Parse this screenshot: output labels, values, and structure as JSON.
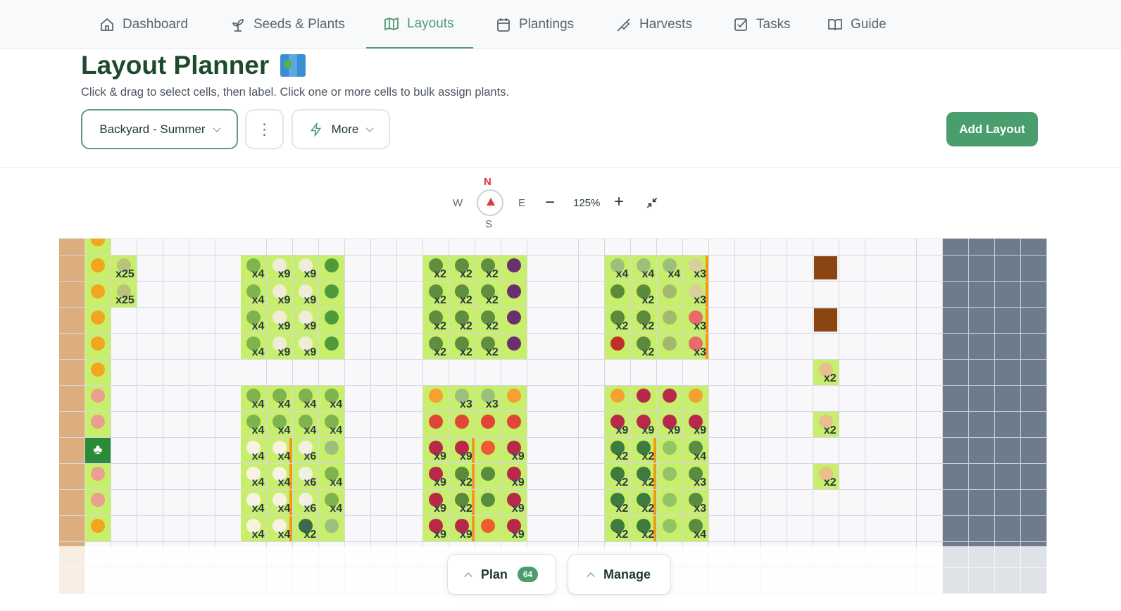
{
  "nav": {
    "items": [
      {
        "label": "Dashboard",
        "icon": "home-icon"
      },
      {
        "label": "Seeds & Plants",
        "icon": "sprout-icon"
      },
      {
        "label": "Layouts",
        "icon": "map-icon",
        "active": true
      },
      {
        "label": "Plantings",
        "icon": "calendar-icon"
      },
      {
        "label": "Harvests",
        "icon": "shovel-icon"
      },
      {
        "label": "Tasks",
        "icon": "checkbox-icon"
      },
      {
        "label": "Guide",
        "icon": "book-icon"
      }
    ]
  },
  "header": {
    "title": "Layout Planner",
    "subtitle": "Click & drag to select cells, then label. Click one or more cells to bulk assign plants.",
    "layout_select": "Backyard - Summer",
    "more_label": "More",
    "add_label": "Add Layout"
  },
  "view": {
    "north": "N",
    "south": "S",
    "west": "W",
    "east": "E",
    "zoom": "125%"
  },
  "bottom": {
    "plan_label": "Plan",
    "plan_count": "64",
    "manage_label": "Manage"
  },
  "colors": {
    "accent": "#4a9d6d",
    "planted": "#c8ef6c",
    "path": "#dcae7e",
    "wall": "#6e7b8c",
    "soil": "#8b4513",
    "divider": "#f29b12"
  },
  "plants": {
    "sunflower": "#f4a520",
    "pinkflower": "#e9a08e",
    "leek": "#b9c47a",
    "lettuce": "#7fb34e",
    "onion": "#f0ecd8",
    "zucchini": "#4f9a3a",
    "broccoli": "#5e8e3e",
    "eggplant": "#6a2f6e",
    "parsley": "#9cc07c",
    "potato": "#d8cf9a",
    "seedling": "#5b8a3a",
    "pumpkin": "#a3b86e",
    "watermelon": "#e86a6a",
    "chili": "#c0302a",
    "marigold": "#f5a030",
    "beet": "#b8284a",
    "pepper": "#e04535",
    "daisy": "#f7f2e2",
    "bean": "#f2efe4",
    "tomato": "#f05a30",
    "spinach": "#3f7a3e",
    "cucumber": "#92c466",
    "basil": "#5a8c40",
    "squash": "#3d6a4a",
    "russet": "#e8c08a"
  },
  "garden": {
    "rows": [
      [
        [
          1,
          "sunflower"
        ]
      ],
      [
        [
          1,
          "sunflower"
        ],
        [
          2,
          "leek",
          "x25"
        ],
        [
          7,
          "lettuce",
          "x4"
        ],
        [
          8,
          "onion",
          "x9"
        ],
        [
          9,
          "onion",
          "x9"
        ],
        [
          10,
          "zucchini"
        ],
        [
          14,
          "broccoli",
          "x2"
        ],
        [
          15,
          "broccoli",
          "x2"
        ],
        [
          16,
          "broccoli",
          "x2"
        ],
        [
          17,
          "eggplant"
        ],
        [
          21,
          "parsley",
          "x4"
        ],
        [
          22,
          "parsley",
          "x4"
        ],
        [
          23,
          "parsley",
          "x4"
        ],
        [
          24,
          "potato",
          "x3",
          1
        ],
        [
          29,
          "soil"
        ]
      ],
      [
        [
          1,
          "sunflower"
        ],
        [
          2,
          "leek",
          "x25"
        ],
        [
          7,
          "lettuce",
          "x4"
        ],
        [
          8,
          "onion",
          "x9"
        ],
        [
          9,
          "onion",
          "x9"
        ],
        [
          10,
          "zucchini"
        ],
        [
          14,
          "broccoli",
          "x2"
        ],
        [
          15,
          "broccoli",
          "x2"
        ],
        [
          16,
          "broccoli",
          "x2"
        ],
        [
          17,
          "eggplant"
        ],
        [
          21,
          "seedling"
        ],
        [
          22,
          "seedling",
          "x2"
        ],
        [
          23,
          "pumpkin"
        ],
        [
          24,
          "potato",
          "x3",
          1
        ]
      ],
      [
        [
          1,
          "sunflower"
        ],
        [
          7,
          "lettuce",
          "x4"
        ],
        [
          8,
          "onion",
          "x9"
        ],
        [
          9,
          "onion",
          "x9"
        ],
        [
          10,
          "zucchini"
        ],
        [
          14,
          "broccoli",
          "x2"
        ],
        [
          15,
          "broccoli",
          "x2"
        ],
        [
          16,
          "broccoli",
          "x2"
        ],
        [
          17,
          "eggplant"
        ],
        [
          21,
          "seedling",
          "x2"
        ],
        [
          22,
          "seedling",
          "x2"
        ],
        [
          23,
          "pumpkin"
        ],
        [
          24,
          "watermelon",
          "x3",
          1
        ],
        [
          29,
          "soil"
        ]
      ],
      [
        [
          1,
          "sunflower"
        ],
        [
          7,
          "lettuce",
          "x4"
        ],
        [
          8,
          "onion",
          "x9"
        ],
        [
          9,
          "onion",
          "x9"
        ],
        [
          10,
          "zucchini"
        ],
        [
          14,
          "broccoli",
          "x2"
        ],
        [
          15,
          "broccoli",
          "x2"
        ],
        [
          16,
          "broccoli",
          "x2"
        ],
        [
          17,
          "eggplant"
        ],
        [
          21,
          "chili"
        ],
        [
          22,
          "seedling",
          "x2"
        ],
        [
          23,
          "pumpkin"
        ],
        [
          24,
          "watermelon",
          "x3",
          1
        ]
      ],
      [
        [
          1,
          "sunflower"
        ],
        [
          29,
          "russet",
          "x2"
        ]
      ],
      [
        [
          1,
          "pinkflower"
        ],
        [
          7,
          "lettuce",
          "x4"
        ],
        [
          8,
          "lettuce",
          "x4"
        ],
        [
          9,
          "lettuce",
          "x4"
        ],
        [
          10,
          "lettuce",
          "x4"
        ],
        [
          14,
          "marigold"
        ],
        [
          15,
          "parsley",
          "x3"
        ],
        [
          16,
          "parsley",
          "x3"
        ],
        [
          17,
          "marigold"
        ],
        [
          21,
          "marigold"
        ],
        [
          22,
          "beet"
        ],
        [
          23,
          "beet"
        ],
        [
          24,
          "marigold"
        ]
      ],
      [
        [
          1,
          "pinkflower"
        ],
        [
          7,
          "lettuce",
          "x4"
        ],
        [
          8,
          "lettuce",
          "x4"
        ],
        [
          9,
          "lettuce",
          "x4"
        ],
        [
          10,
          "lettuce",
          "x4"
        ],
        [
          14,
          "pepper"
        ],
        [
          15,
          "pepper"
        ],
        [
          16,
          "pepper"
        ],
        [
          17,
          "pepper"
        ],
        [
          21,
          "beet",
          "x9"
        ],
        [
          22,
          "beet",
          "x9"
        ],
        [
          23,
          "beet",
          "x9"
        ],
        [
          24,
          "beet",
          "x9"
        ],
        [
          29,
          "russet",
          "x2"
        ]
      ],
      [
        [
          1,
          "tree"
        ],
        [
          7,
          "daisy",
          "x4"
        ],
        [
          8,
          "daisy",
          "x4",
          1
        ],
        [
          9,
          "bean",
          "x6"
        ],
        [
          10,
          "parsley"
        ],
        [
          14,
          "beet",
          "x9"
        ],
        [
          15,
          "beet",
          "x9",
          1
        ],
        [
          16,
          "tomato"
        ],
        [
          17,
          "beet",
          "x9"
        ],
        [
          21,
          "spinach",
          "x2"
        ],
        [
          22,
          "spinach",
          "x2",
          1
        ],
        [
          23,
          "cucumber"
        ],
        [
          24,
          "basil",
          "x4"
        ]
      ],
      [
        [
          1,
          "pinkflower"
        ],
        [
          7,
          "daisy",
          "x4"
        ],
        [
          8,
          "daisy",
          "x4",
          1
        ],
        [
          9,
          "bean",
          "x6"
        ],
        [
          10,
          "lettuce",
          "x4"
        ],
        [
          14,
          "beet",
          "x9"
        ],
        [
          15,
          "seedling",
          "x2",
          1
        ],
        [
          16,
          "basil"
        ],
        [
          17,
          "beet",
          "x9"
        ],
        [
          21,
          "spinach",
          "x2"
        ],
        [
          22,
          "spinach",
          "x2",
          1
        ],
        [
          23,
          "cucumber"
        ],
        [
          24,
          "basil",
          "x3"
        ],
        [
          29,
          "russet",
          "x2"
        ]
      ],
      [
        [
          1,
          "pinkflower"
        ],
        [
          7,
          "daisy",
          "x4"
        ],
        [
          8,
          "daisy",
          "x4",
          1
        ],
        [
          9,
          "bean",
          "x6"
        ],
        [
          10,
          "lettuce",
          "x4"
        ],
        [
          14,
          "beet",
          "x9"
        ],
        [
          15,
          "seedling",
          "x2",
          1
        ],
        [
          16,
          "basil"
        ],
        [
          17,
          "beet",
          "x9"
        ],
        [
          21,
          "spinach",
          "x2"
        ],
        [
          22,
          "spinach",
          "x2",
          1
        ],
        [
          23,
          "cucumber"
        ],
        [
          24,
          "basil",
          "x3"
        ]
      ],
      [
        [
          1,
          "sunflower"
        ],
        [
          7,
          "daisy",
          "x4"
        ],
        [
          8,
          "daisy",
          "x4",
          1
        ],
        [
          9,
          "squash",
          "x2"
        ],
        [
          10,
          "parsley"
        ],
        [
          14,
          "beet",
          "x9"
        ],
        [
          15,
          "beet",
          "x9",
          1
        ],
        [
          16,
          "tomato"
        ],
        [
          17,
          "beet",
          "x9"
        ],
        [
          21,
          "spinach",
          "x2"
        ],
        [
          22,
          "spinach",
          "x2",
          1
        ],
        [
          23,
          "cucumber"
        ],
        [
          24,
          "basil",
          "x4"
        ]
      ]
    ]
  }
}
